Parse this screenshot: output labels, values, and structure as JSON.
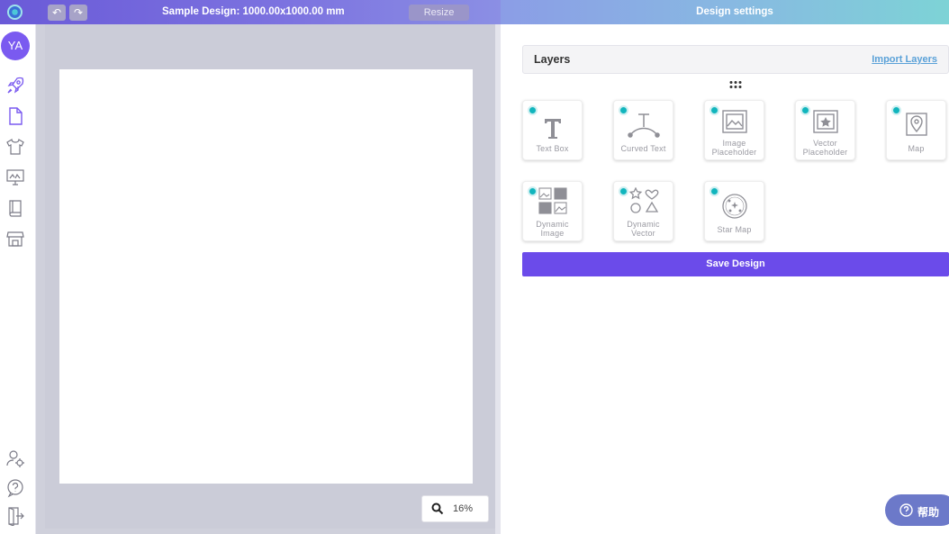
{
  "header": {
    "design_title": "Sample Design: 1000.00x1000.00 mm",
    "resize_label": "Resize",
    "undo_glyph": "↶",
    "redo_glyph": "↷",
    "settings_title": "Design settings"
  },
  "sidebar": {
    "avatar_initials": "YA",
    "items": [
      {
        "icon": "rocket-icon"
      },
      {
        "icon": "document-icon"
      },
      {
        "icon": "tshirt-icon"
      },
      {
        "icon": "monitor-gallery-icon"
      },
      {
        "icon": "book-icon"
      },
      {
        "icon": "storefront-icon"
      },
      {
        "icon": "user-settings-icon"
      },
      {
        "icon": "help-circle-icon"
      },
      {
        "icon": "exit-icon"
      }
    ]
  },
  "canvas": {
    "zoom": "16%"
  },
  "panel": {
    "layers_title": "Layers",
    "import_label": "Import Layers",
    "tiles": [
      {
        "name": "text-box",
        "label": "Text Box",
        "icon": "text-icon"
      },
      {
        "name": "curved-text",
        "label": "Curved Text",
        "icon": "curved-text-icon"
      },
      {
        "name": "image-placeholder",
        "label1": "Image",
        "label2": "Placeholder",
        "icon": "image-icon"
      },
      {
        "name": "vector-placeholder",
        "label1": "Vector",
        "label2": "Placeholder",
        "icon": "vector-icon"
      },
      {
        "name": "map",
        "label": "Map",
        "icon": "map-pin-icon"
      },
      {
        "name": "dynamic-image",
        "label1": "Dynamic",
        "label2": "Image",
        "icon": "dynamic-image-icon"
      },
      {
        "name": "dynamic-vector",
        "label1": "Dynamic",
        "label2": "Vector",
        "icon": "shapes-icon"
      },
      {
        "name": "star-map",
        "label": "Star Map",
        "icon": "star-map-icon"
      }
    ],
    "save_label": "Save Design"
  },
  "help": {
    "label": "帮助"
  },
  "colors": {
    "accent": "#6b4bea",
    "teal_dot": "#11b5bd"
  }
}
